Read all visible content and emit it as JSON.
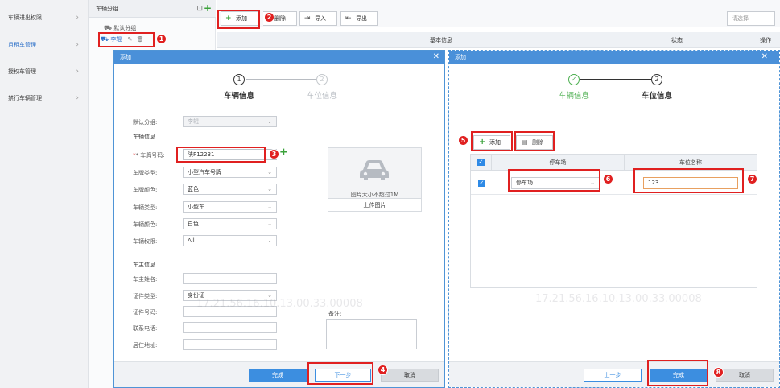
{
  "sidebar": {
    "items": [
      {
        "label": "车辆进出权限"
      },
      {
        "label": "月租车管理"
      },
      {
        "label": "授权车管理"
      },
      {
        "label": "禁行车辆管理"
      }
    ]
  },
  "group_panel": {
    "title": "车辆分组",
    "default_group": "默认分组",
    "sub_group": "李辊"
  },
  "toolbar": {
    "add": "添加",
    "delete": "删除",
    "import": "导入",
    "export": "导出",
    "select_placeholder": "请选择"
  },
  "table_header": {
    "basic_info": "基本信息",
    "status": "状态",
    "operation": "操作"
  },
  "modal_left": {
    "title": "添加",
    "steps": [
      {
        "num": "1",
        "label": "车辆信息"
      },
      {
        "num": "2",
        "label": "车位信息"
      }
    ],
    "fields": {
      "default_group_label": "默认分组:",
      "default_group_value": "李辊",
      "section_vehicle": "车辆信息",
      "plate_label": "* 车牌号码:",
      "plate_value": "陕P12231",
      "plate_type_label": "车牌类型:",
      "plate_type_value": "小型汽车号牌",
      "plate_color_label": "车牌颜色:",
      "plate_color_value": "蓝色",
      "vehicle_type_label": "车辆类型:",
      "vehicle_type_value": "小型车",
      "vehicle_color_label": "车辆颜色:",
      "vehicle_color_value": "白色",
      "permission_label": "车辆权限:",
      "permission_value": "All",
      "section_owner": "车主信息",
      "owner_name_label": "车主姓名:",
      "id_type_label": "证件类型:",
      "id_type_value": "身份证",
      "id_no_label": "证件号码:",
      "phone_label": "联系电话:",
      "address_label": "居住地址:",
      "remark_label": "备注:"
    },
    "upload": {
      "hint": "图片大小不超过1M",
      "button": "上传图片"
    },
    "footer": {
      "finish": "完成",
      "next": "下一步",
      "cancel": "取消"
    }
  },
  "modal_right": {
    "title": "添加",
    "steps": [
      {
        "num": "✓",
        "label": "车辆信息"
      },
      {
        "num": "2",
        "label": "车位信息"
      }
    ],
    "add": "添加",
    "delete": "删除",
    "table": {
      "col_lot": "停车场",
      "col_space": "车位名称",
      "row_lot": "停车场",
      "row_space": "123"
    },
    "footer": {
      "prev": "上一步",
      "finish": "完成",
      "cancel": "取消"
    }
  },
  "badges": [
    "1",
    "2",
    "3",
    "4",
    "5",
    "6",
    "7",
    "8"
  ],
  "watermark": "17.21.56.16.10.13.00.33.00008"
}
